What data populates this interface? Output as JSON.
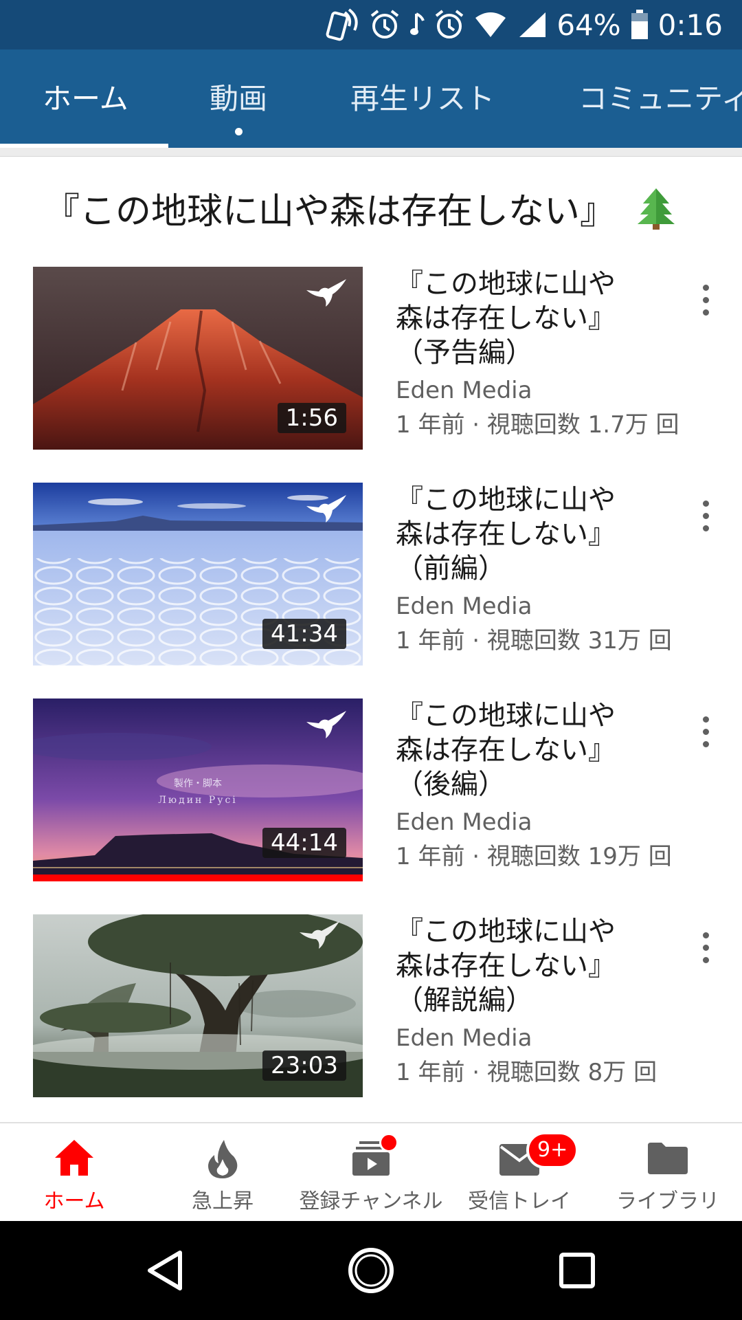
{
  "status_bar": {
    "battery": "64%",
    "time": "0:16",
    "icons": [
      "nfc-icon",
      "alarm-icon",
      "music-note-icon",
      "alarm-icon",
      "wifi-icon",
      "signal-icon",
      "battery-icon"
    ]
  },
  "tabs": [
    {
      "label": "ホーム",
      "active": true
    },
    {
      "label": "動画",
      "active": false
    },
    {
      "label": "再生リスト",
      "active": false
    },
    {
      "label": "コミュニティ",
      "active": false
    }
  ],
  "section": {
    "title": "『この地球に山や森は存在しない』",
    "emoji": "🌲"
  },
  "videos": [
    {
      "title_lines": [
        "『この地球に山や",
        "森は存在しない』",
        "（予告編）"
      ],
      "channel": "Eden Media",
      "meta": "1 年前 · 視聴回数 1.7万 回",
      "duration": "1:56",
      "thumbnail": "red-mountain-peak",
      "watched_fraction": 0
    },
    {
      "title_lines": [
        "『この地球に山や",
        "森は存在しない』",
        "（前編）"
      ],
      "channel": "Eden Media",
      "meta": "1 年前 · 視聴回数 31万 回",
      "duration": "41:34",
      "thumbnail": "salt-flat",
      "watched_fraction": 0
    },
    {
      "title_lines": [
        "『この地球に山や",
        "森は存在しない』",
        "（後編）"
      ],
      "channel": "Eden Media",
      "meta": "1 年前 · 視聴回数 19万 回",
      "duration": "44:14",
      "thumbnail": "purple-sunset-table-mountain",
      "overlay_lines": [
        "製作・脚本",
        "Людин Русi"
      ],
      "watched_fraction": 1
    },
    {
      "title_lines": [
        "『この地球に山や",
        "森は存在しない』",
        "（解説編）"
      ],
      "channel": "Eden Media",
      "meta": "1 年前 · 視聴回数 8万 回",
      "duration": "23:03",
      "thumbnail": "giant-tree-forest",
      "watched_fraction": 0
    }
  ],
  "bottom_nav": [
    {
      "label": "ホーム",
      "icon": "home-icon",
      "active": true
    },
    {
      "label": "急上昇",
      "icon": "flame-icon",
      "active": false
    },
    {
      "label": "登録チャンネル",
      "icon": "subscriptions-icon",
      "active": false,
      "dot": true
    },
    {
      "label": "受信トレイ",
      "icon": "inbox-mail-icon",
      "active": false,
      "badge": "9+"
    },
    {
      "label": "ライブラリ",
      "icon": "folder-icon",
      "active": false
    }
  ],
  "colors": {
    "status_bar": "#154a78",
    "tab_bar": "#1b5e92",
    "accent_red": "#ff0000",
    "secondary_text": "#606060"
  }
}
